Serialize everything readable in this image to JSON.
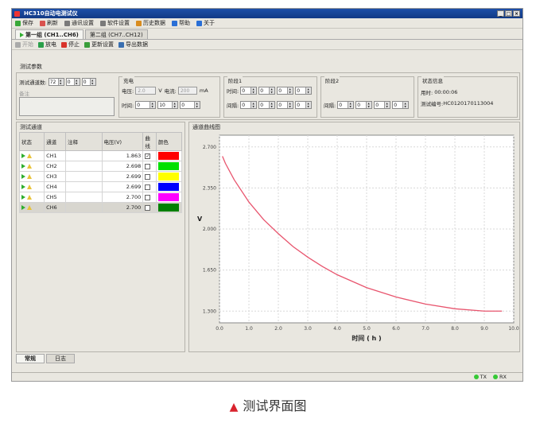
{
  "window": {
    "title": "HC310自动电测试仪",
    "controls": [
      "_",
      "□",
      "×"
    ]
  },
  "menu": [
    {
      "label": "保存",
      "icon": "play-icon",
      "color": "#39a839"
    },
    {
      "label": "刷新",
      "icon": "refresh-icon",
      "color": "#d9534f"
    },
    {
      "label": "通讯设置",
      "icon": "settings-icon",
      "color": "#7a7a7a"
    },
    {
      "label": "软件设置",
      "icon": "gear-icon",
      "color": "#7a7a7a"
    },
    {
      "label": "历史数据",
      "icon": "history-icon",
      "color": "#d98c1f"
    },
    {
      "label": "帮助",
      "icon": "help-icon",
      "color": "#2a6fd6"
    },
    {
      "label": "关于",
      "icon": "info-icon",
      "color": "#2a6fd6"
    }
  ],
  "tabs": [
    "第一组 (CH1..CH6)",
    "第二组 (CH7..CH12)"
  ],
  "toolbar": [
    {
      "label": "开始",
      "icon": "start-icon",
      "disabled": true
    },
    {
      "label": "放电",
      "icon": "discharge-icon",
      "disabled": false
    },
    {
      "label": "停止",
      "icon": "stop-icon",
      "disabled": false
    },
    {
      "label": "更新设置",
      "icon": "update-icon",
      "disabled": false
    },
    {
      "label": "导出数据",
      "icon": "export-icon",
      "disabled": false
    }
  ],
  "params": {
    "title": "测试参数",
    "channel_count_label": "测试通道数:",
    "channel_count": "72",
    "spin_a": "0",
    "spin_b": "0",
    "note_label": "备注",
    "discharge": {
      "title": "充电",
      "voltage_label": "电压:",
      "voltage_value": "2.0",
      "voltage_unit": "V",
      "current_label": "电流:",
      "current_value": "200",
      "current_unit": "mA",
      "time_label": "时间:",
      "time_values": [
        "0",
        "10",
        "0"
      ]
    },
    "stage1": {
      "title": "阶段1",
      "time_label": "时间:",
      "time_values": [
        "0",
        "0",
        "0",
        "0"
      ],
      "interval_label": "间隔:",
      "interval_values": [
        "0",
        "0",
        "0",
        "0"
      ]
    },
    "stage2": {
      "title": "阶段2",
      "interval_label": "间隔:",
      "interval_values": [
        "0",
        "0",
        "0",
        "0"
      ]
    },
    "status": {
      "title": "状态信息",
      "elapsed_label": "用时:",
      "elapsed_value": "00:00:06",
      "test_id_label": "测试编号:",
      "test_id_value": "HC0120170113004"
    }
  },
  "channels": {
    "title": "测试通道",
    "headers": [
      "状态",
      "通道",
      "注释",
      "电压(V)",
      "曲线",
      "颜色"
    ],
    "rows": [
      {
        "name": "CH1",
        "note": "",
        "voltage": "1.863",
        "checked": true,
        "color": "#ff0000",
        "selected": false
      },
      {
        "name": "CH2",
        "note": "",
        "voltage": "2.698",
        "checked": false,
        "color": "#00e000",
        "selected": false
      },
      {
        "name": "CH3",
        "note": "",
        "voltage": "2.699",
        "checked": false,
        "color": "#ffff00",
        "selected": false
      },
      {
        "name": "CH4",
        "note": "",
        "voltage": "2.699",
        "checked": false,
        "color": "#0000ff",
        "selected": false
      },
      {
        "name": "CH5",
        "note": "",
        "voltage": "2.700",
        "checked": false,
        "color": "#ff00ff",
        "selected": false
      },
      {
        "name": "CH6",
        "note": "",
        "voltage": "2.700",
        "checked": false,
        "color": "#008000",
        "selected": true
      }
    ]
  },
  "chart_data": {
    "type": "line",
    "title": "通道曲线图",
    "xlabel": "时间 ( h )",
    "ylabel": "V",
    "xlim": [
      0,
      10
    ],
    "ylim": [
      1.2,
      2.8
    ],
    "xticks": [
      "0.0",
      "1.0",
      "2.0",
      "3.0",
      "4.0",
      "5.0",
      "6.0",
      "7.0",
      "8.0",
      "9.0",
      "10.0"
    ],
    "yticks": [
      "1.300",
      "1.650",
      "2.000",
      "2.350",
      "2.700"
    ],
    "grid": true,
    "series": [
      {
        "color": "#e8556e",
        "x": [
          0.1,
          0.2,
          0.5,
          1.0,
          1.5,
          2.0,
          2.5,
          3.0,
          3.5,
          4.0,
          5.0,
          6.0,
          7.0,
          8.0,
          9.0,
          9.6
        ],
        "y": [
          2.62,
          2.56,
          2.42,
          2.23,
          2.08,
          1.96,
          1.85,
          1.76,
          1.68,
          1.61,
          1.5,
          1.42,
          1.36,
          1.32,
          1.3,
          1.3
        ]
      }
    ]
  },
  "bottom_tabs": [
    "常规",
    "日志"
  ],
  "statusbar": {
    "tx": "TX",
    "rx": "RX"
  },
  "caption": "测试界面图"
}
